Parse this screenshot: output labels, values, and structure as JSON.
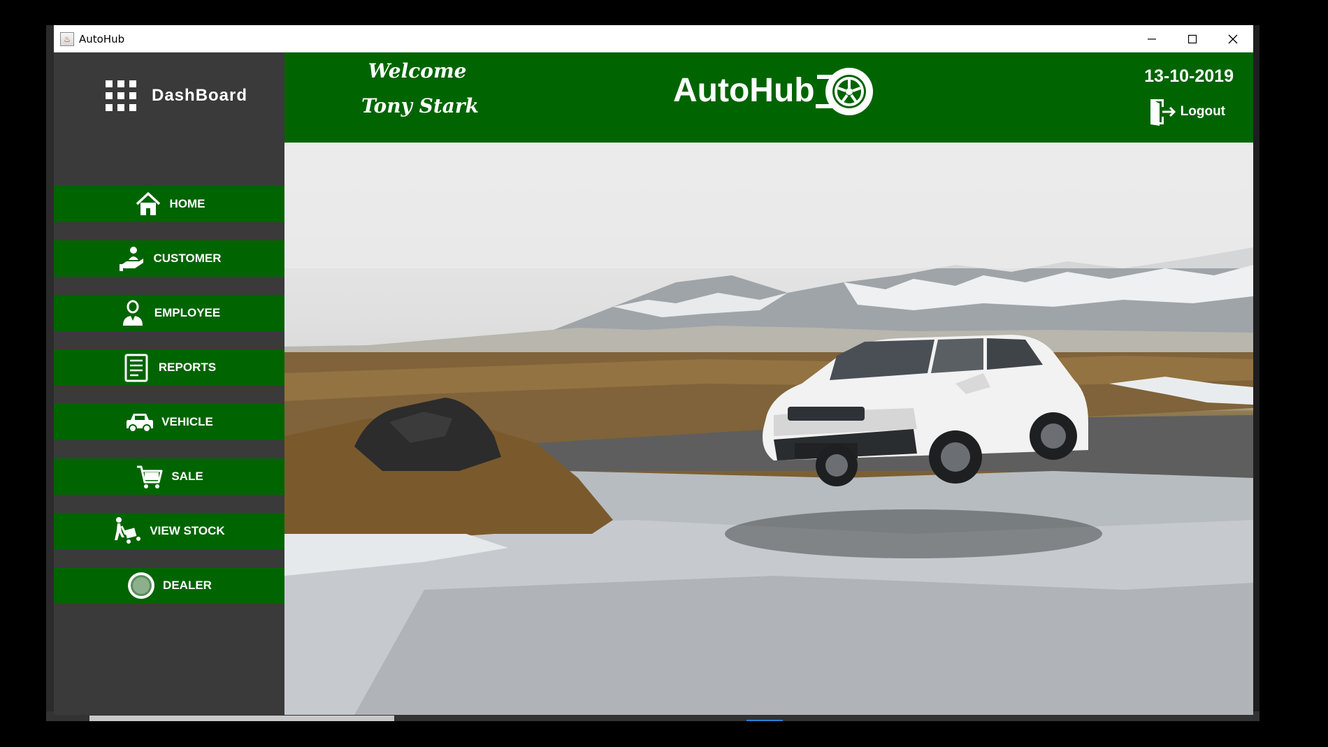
{
  "window": {
    "title": "AutoHub"
  },
  "window_controls": {
    "minimize": "–",
    "maximize": "☐",
    "close": "✕"
  },
  "sidebar": {
    "header_label": "DashBoard",
    "items": [
      {
        "label": "HOME",
        "icon": "home-icon"
      },
      {
        "label": "CUSTOMER",
        "icon": "customer-icon"
      },
      {
        "label": "EMPLOYEE",
        "icon": "employee-icon"
      },
      {
        "label": "REPORTS",
        "icon": "reports-icon"
      },
      {
        "label": "VEHICLE",
        "icon": "car-icon"
      },
      {
        "label": "SALE",
        "icon": "cart-icon"
      },
      {
        "label": "VIEW STOCK",
        "icon": "stock-trolley-icon"
      },
      {
        "label": "DEALER",
        "icon": "dealer-badge-icon"
      }
    ]
  },
  "header": {
    "welcome": "Welcome",
    "user_name": "Tony Stark",
    "brand": "AutoHub",
    "date": "13-10-2019",
    "logout_label": "Logout"
  },
  "colors": {
    "accent": "#006400",
    "sidebar_bg": "#3a3a3a"
  }
}
